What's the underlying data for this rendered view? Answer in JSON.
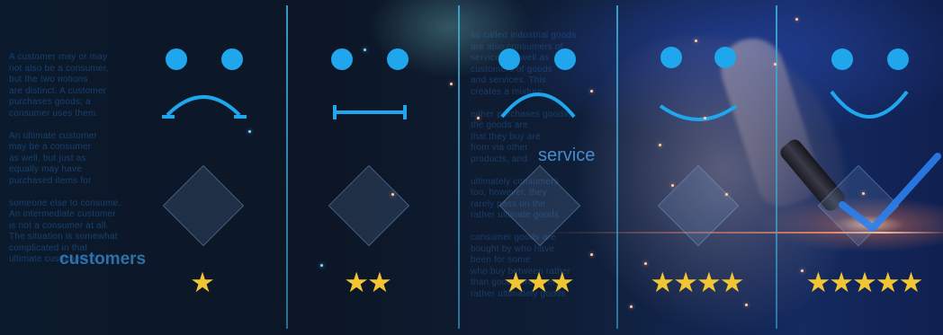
{
  "background_text": {
    "left_paragraph": "A customer may or may\nnot also be a consumer,\nbut the two notions\nare distinct. A customer\npurchases goods; a\nconsumer uses them.\n\nAn ultimate customer\nmay be a consumer\nas well, but just as\nequally may have\npurchased items for\n\nsomeone else to consume.\nAn intermediate customer\nis not a consumer at all.\nThe situation is somewhat\ncomplicated in that\nultimate customers of",
    "middle_paragraph": "so called industrial goods\nare also consumers of\nservices as well as\ncustomers of goods\nand services. This\ncreates a mixture.\n\neither purchases goods,\nthe goods are\nthat they buy are\nfrom via other\nproducts, and\n\nultimately consumers\ntoo, however, they\nrarely pass on the\nrather ultimate goods\n\nconsumer goods are\nbought by who have\nbeen for some\nwho buy between rather\nthan goods are rarely\nrather ultimately goods",
    "word_customers": "customers",
    "word_service": "service"
  },
  "ratings": [
    {
      "stars": "★",
      "rating": 1,
      "face": "sad"
    },
    {
      "stars": "★★",
      "rating": 2,
      "face": "neutral"
    },
    {
      "stars": "★★★",
      "rating": 3,
      "face": "slight-frown"
    },
    {
      "stars": "★★★★",
      "rating": 4,
      "face": "slight-smile"
    },
    {
      "stars": "★★★★★",
      "rating": 5,
      "face": "happy"
    }
  ],
  "colors": {
    "face": "#1fa6ec",
    "star": "#f2c632",
    "divider": "#3caad2",
    "checkmark": "#2a7ff0"
  },
  "icons": [
    "sad-face-icon",
    "neutral-face-icon",
    "frown-face-icon",
    "smile-face-icon",
    "happy-face-icon",
    "check-icon",
    "star-icon"
  ]
}
